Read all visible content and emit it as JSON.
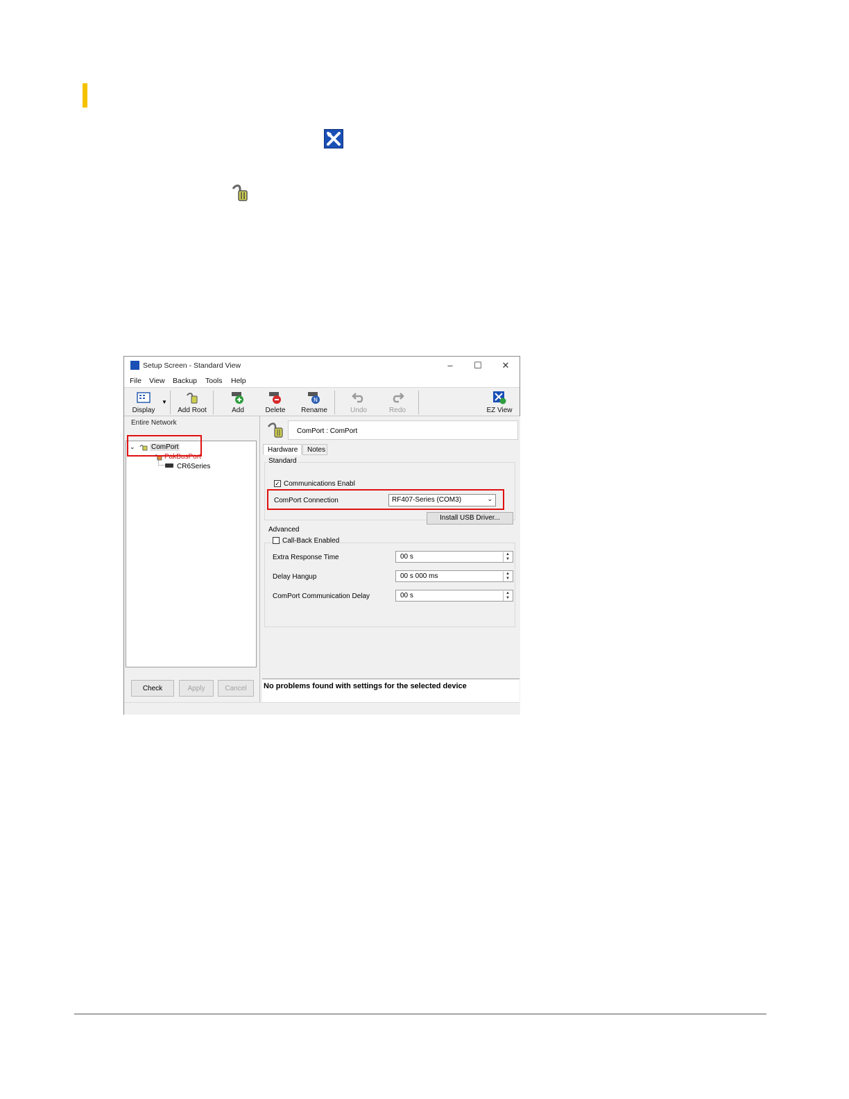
{
  "window": {
    "title": "Setup Screen - Standard View",
    "controls": {
      "minimize": "–",
      "maximize": "☐",
      "close": "✕"
    }
  },
  "menu": [
    "File",
    "View",
    "Backup",
    "Tools",
    "Help"
  ],
  "toolbar": {
    "display": "Display",
    "add_root": "Add Root",
    "add": "Add",
    "delete": "Delete",
    "rename": "Rename",
    "undo": "Undo",
    "redo": "Redo",
    "ez_view": "EZ View"
  },
  "left_pane": {
    "heading": "Entire Network",
    "tree": {
      "root": "ComPort",
      "child": "PakBusPort",
      "grandchild": "CR6Series"
    },
    "buttons": {
      "check": "Check",
      "apply": "Apply",
      "cancel": "Cancel"
    }
  },
  "right_pane": {
    "header": "ComPort : ComPort",
    "tabs": [
      "Hardware",
      "Notes"
    ],
    "standard": {
      "title": "Standard",
      "comm_enabled_label": "Communications Enabl",
      "comm_enabled_checked": true,
      "comport_connection_label": "ComPort Connection",
      "comport_connection_value": "RF407-Series (COM3)",
      "install_usb_driver": "Install USB Driver..."
    },
    "advanced": {
      "title": "Advanced",
      "callback_label": "Call-Back Enabled",
      "callback_checked": false,
      "extra_response_label": "Extra Response Time",
      "extra_response_value": "00 s",
      "delay_hangup_label": "Delay Hangup",
      "delay_hangup_value": "00 s 000 ms",
      "comm_delay_label": "ComPort Communication Delay",
      "comm_delay_value": "00 s"
    },
    "status": "No problems found with settings for the selected device"
  },
  "colors": {
    "accent": "#f5c200",
    "highlight": "#e01010",
    "icon_blue": "#1a4fb5"
  }
}
